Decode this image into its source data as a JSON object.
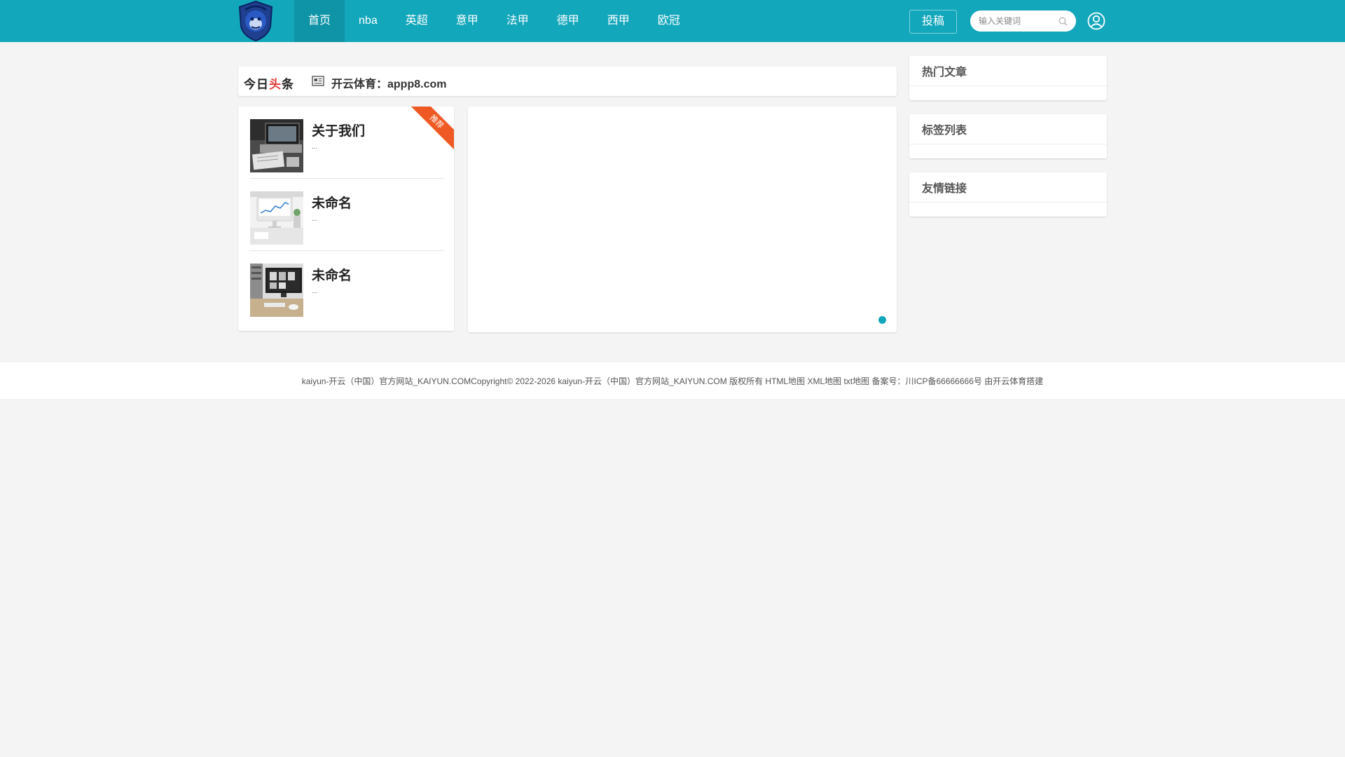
{
  "header": {
    "logo_icon": "monkey-shield-logo-icon",
    "nav": [
      {
        "label": "首页",
        "active": true
      },
      {
        "label": "nba",
        "active": false
      },
      {
        "label": "英超",
        "active": false
      },
      {
        "label": "意甲",
        "active": false
      },
      {
        "label": "法甲",
        "active": false
      },
      {
        "label": "德甲",
        "active": false
      },
      {
        "label": "西甲",
        "active": false
      },
      {
        "label": "欧冠",
        "active": false
      }
    ],
    "submit_label": "投稿",
    "search_placeholder": "输入关键词",
    "colors": {
      "bar": "#13a7bb",
      "active": "#0f94a7"
    }
  },
  "headline": {
    "brand_part1": "今日",
    "brand_part2": "头",
    "brand_part3": "条",
    "icon": "newspaper-icon",
    "text": "开云体育：appp8.com"
  },
  "recommend": {
    "ribbon": "推荐",
    "items": [
      {
        "title": "关于我们",
        "desc": "..."
      },
      {
        "title": "未命名",
        "desc": "..."
      },
      {
        "title": "未命名",
        "desc": "..."
      }
    ]
  },
  "carousel": {
    "active_dot": 1,
    "dot_color": "#13a7bb"
  },
  "sidebar": {
    "boxes": [
      {
        "title": "热门文章"
      },
      {
        "title": "标签列表"
      },
      {
        "title": "友情链接"
      }
    ]
  },
  "footer": {
    "text": "kaiyun-开云（中国）官方网站_KAIYUN.COMCopyright© 2022-2026 kaiyun-开云（中国）官方网站_KAIYUN.COM 版权所有",
    "links": [
      "HTML地图",
      "XML地图",
      "txt地图"
    ],
    "icp": "备案号：川ICP备66666666号",
    "powered": "由开云体育搭建"
  }
}
